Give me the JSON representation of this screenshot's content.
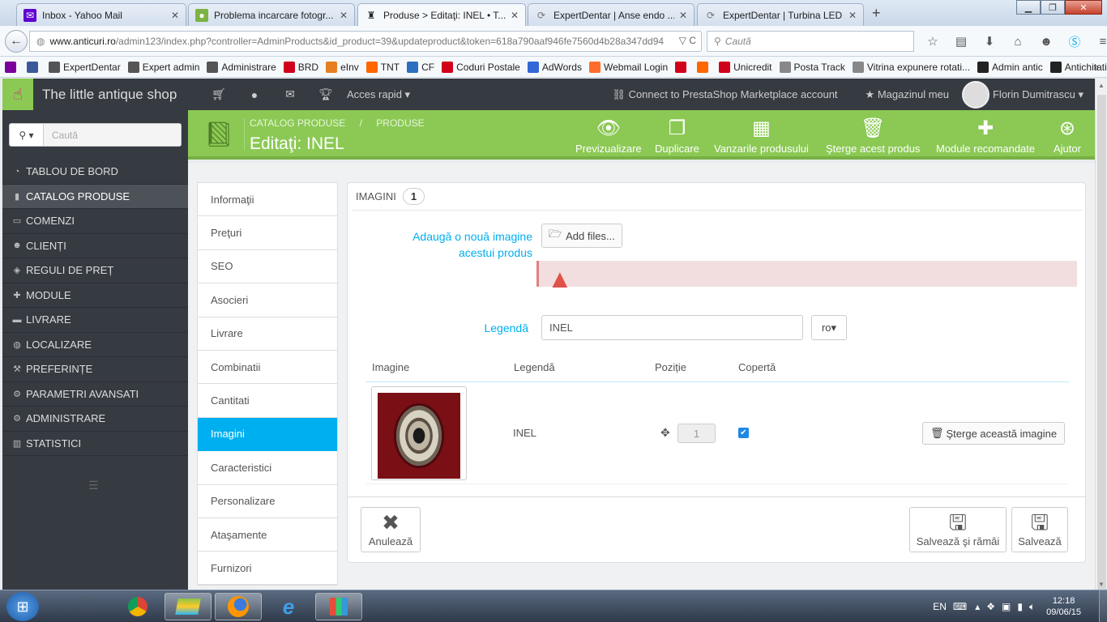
{
  "browser": {
    "tabs": [
      {
        "title": "Inbox - Yahoo Mail",
        "icon": "yahoo-icon",
        "close": "✕"
      },
      {
        "title": "Problema incarcare fotogr...",
        "icon": "forum-icon",
        "close": "✕"
      },
      {
        "title": "Produse > Editaţi: INEL • T...",
        "icon": "prestashop-icon",
        "close": "✕"
      },
      {
        "title": "ExpertDentar | Anse endo ...",
        "icon": "loading-icon",
        "close": "✕"
      },
      {
        "title": "ExpertDentar | Turbina LED",
        "icon": "loading-icon",
        "close": "✕"
      }
    ],
    "new_tab": "+",
    "window_buttons": {
      "minimize": "▁",
      "maximize": "❐",
      "close": "✕"
    },
    "url_domain": "www.anticuri.ro",
    "url_rest": "/admin123/index.php?controller=AdminProducts&id_product=39&updateproduct&token=618a790aaf946fe7560d4b28a347dd94",
    "url_controls": "▽ C",
    "search_placeholder": "Caută",
    "bookmarks": [
      {
        "label": "",
        "color": "#7b0099"
      },
      {
        "label": "",
        "color": "#3b5998"
      },
      {
        "label": "ExpertDentar",
        "color": "#555555"
      },
      {
        "label": "Expert admin",
        "color": "#555555"
      },
      {
        "label": "Administrare",
        "color": "#555555"
      },
      {
        "label": "BRD",
        "color": "#d0021b"
      },
      {
        "label": "eInv",
        "color": "#e67e22"
      },
      {
        "label": "TNT",
        "color": "#ff6600"
      },
      {
        "label": "CF",
        "color": "#2c6fbf"
      },
      {
        "label": "Coduri Postale",
        "color": "#d0021b"
      },
      {
        "label": "AdWords",
        "color": "#3367d6"
      },
      {
        "label": "Webmail Login",
        "color": "#ff6c2c"
      },
      {
        "label": "",
        "color": "#d0021b"
      },
      {
        "label": "",
        "color": "#ff6600"
      },
      {
        "label": "Unicredit",
        "color": "#d0021b"
      },
      {
        "label": "Posta Track",
        "color": "#888888"
      },
      {
        "label": "Vitrina expunere rotati...",
        "color": "#888888"
      },
      {
        "label": "Admin antic",
        "color": "#222222"
      },
      {
        "label": "Antichitati",
        "color": "#222222"
      }
    ],
    "bookmarks_more": "»"
  },
  "header": {
    "shop_name": "The little antique shop",
    "quick_access": "Acces rapid",
    "marketplace": "Connect to PrestaShop Marketplace account",
    "my_shop": "Magazinul meu",
    "user": "Florin Dumitrascu"
  },
  "sidebar": {
    "search_placeholder": "Caută",
    "items": [
      {
        "label": "TABLOU DE BORD",
        "icon": "dashboard-icon",
        "active": false
      },
      {
        "label": "CATALOG PRODUSE",
        "icon": "book-icon",
        "active": true
      },
      {
        "label": "COMENZI",
        "icon": "credit-card-icon",
        "active": false
      },
      {
        "label": "CLIENȚI",
        "icon": "users-icon",
        "active": false
      },
      {
        "label": "REGULI DE PREȚ",
        "icon": "tags-icon",
        "active": false
      },
      {
        "label": "MODULE",
        "icon": "puzzle-icon",
        "active": false
      },
      {
        "label": "LIVRARE",
        "icon": "truck-icon",
        "active": false
      },
      {
        "label": "LOCALIZARE",
        "icon": "globe-icon",
        "active": false
      },
      {
        "label": "PREFERINȚE",
        "icon": "wrench-icon",
        "active": false
      },
      {
        "label": "PARAMETRI AVANSATI",
        "icon": "cogs-icon",
        "active": false
      },
      {
        "label": "ADMINISTRARE",
        "icon": "cog-icon",
        "active": false
      },
      {
        "label": "STATISTICI",
        "icon": "bar-chart-icon",
        "active": false
      }
    ]
  },
  "toolbar": {
    "breadcrumb": [
      "CATALOG PRODUSE",
      "/",
      "PRODUSE"
    ],
    "title": "Editaţi: INEL",
    "buttons": [
      {
        "label": "Previzualizare",
        "icon": "eye-icon"
      },
      {
        "label": "Duplicare",
        "icon": "copy-icon"
      },
      {
        "label": "Vanzarile produsului",
        "icon": "bar-chart-icon"
      },
      {
        "label": "Şterge acest produs",
        "icon": "trash-icon"
      },
      {
        "label": "Module recomandate",
        "icon": "puzzle-icon"
      },
      {
        "label": "Ajutor",
        "icon": "lifebuoy-icon"
      }
    ]
  },
  "product_tabs": [
    {
      "label": "Informaţii",
      "active": false
    },
    {
      "label": "Preţuri",
      "active": false
    },
    {
      "label": "SEO",
      "active": false
    },
    {
      "label": "Asocieri",
      "active": false
    },
    {
      "label": "Livrare",
      "active": false
    },
    {
      "label": "Combinatii",
      "active": false
    },
    {
      "label": "Cantitati",
      "active": false
    },
    {
      "label": "Imagini",
      "active": true
    },
    {
      "label": "Caracteristici",
      "active": false
    },
    {
      "label": "Personalizare",
      "active": false
    },
    {
      "label": "Ataşamente",
      "active": false
    },
    {
      "label": "Furnizori",
      "active": false
    }
  ],
  "images_panel": {
    "title": "IMAGINI",
    "count": "1",
    "add_label_line1": "Adaugă o nouă imagine",
    "add_label_line2": "acestui produs",
    "add_files": "Add files...",
    "legend_label": "Legendă",
    "legend_value": "INEL",
    "language": "ro",
    "columns": [
      "Imagine",
      "Legendă",
      "Poziție",
      "Copertă"
    ],
    "rows": [
      {
        "legend": "INEL",
        "position": "1",
        "cover": true,
        "delete": "Şterge această imagine"
      }
    ],
    "cancel": "Anulează",
    "save_stay": "Salvează şi rămâi",
    "save": "Salvează"
  },
  "taskbar": {
    "lang": "EN",
    "time": "12:18",
    "date": "09/06/15"
  }
}
